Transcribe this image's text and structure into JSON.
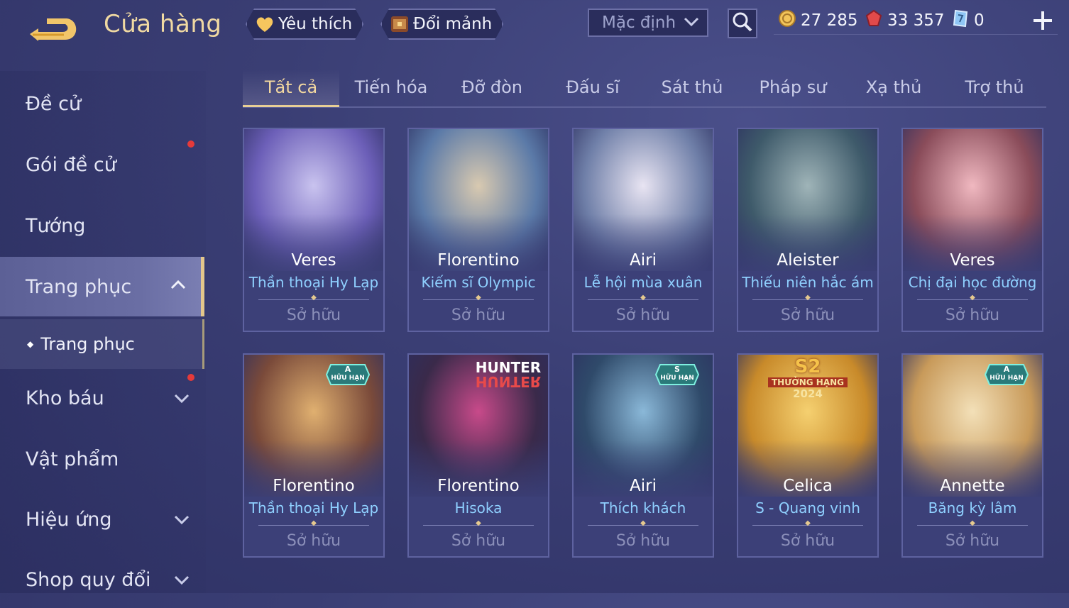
{
  "header": {
    "title": "Cửa hàng",
    "favorites_label": "Yêu thích",
    "exchange_label": "Đổi mảnh",
    "sort_value": "Mặc định",
    "currencies": [
      {
        "icon": "gold-coin-icon",
        "value": "27 285"
      },
      {
        "icon": "red-gem-icon",
        "value": "33 357"
      },
      {
        "icon": "voucher-icon",
        "value": "0"
      }
    ]
  },
  "sidebar": {
    "items": [
      {
        "label": "Đề cử"
      },
      {
        "label": "Gói đề cử"
      },
      {
        "label": "Tướng"
      },
      {
        "label": "Trang phục"
      },
      {
        "label": "Trang phục"
      },
      {
        "label": "Kho báu"
      },
      {
        "label": "Vật phẩm"
      },
      {
        "label": "Hiệu ứng"
      },
      {
        "label": "Shop quy đổi"
      }
    ]
  },
  "tabs": [
    "Tất cả",
    "Tiến hóa",
    "Đỡ đòn",
    "Đấu sĩ",
    "Sát thủ",
    "Pháp sư",
    "Xạ thủ",
    "Trợ thủ"
  ],
  "cards": [
    {
      "hero": "Veres",
      "skin": "Thần thoại Hy Lạp",
      "status": "Sở hữu",
      "palette": [
        "#6c5fb8",
        "#c9c3ef"
      ]
    },
    {
      "hero": "Florentino",
      "skin": "Kiếm sĩ Olympic",
      "status": "Sở hữu",
      "palette": [
        "#5b7aa8",
        "#d8c9b0"
      ]
    },
    {
      "hero": "Airi",
      "skin": "Lễ hội mùa xuân",
      "status": "Sở hữu",
      "palette": [
        "#6f7fa8",
        "#e8e4f2"
      ]
    },
    {
      "hero": "Aleister",
      "skin": "Thiếu niên hắc ám",
      "status": "Sở hữu",
      "palette": [
        "#3e5a6a",
        "#9fb4b8"
      ]
    },
    {
      "hero": "Veres",
      "skin": "Chị đại học đường",
      "status": "Sở hữu",
      "palette": [
        "#8a4c5a",
        "#f0b8c0"
      ]
    },
    {
      "hero": "Florentino",
      "skin": "Thần thoại Hy Lạp",
      "status": "Sở hữu",
      "palette": [
        "#7a4a3a",
        "#e0b070"
      ],
      "badge": {
        "grade": "A",
        "text": "HỮU HẠN"
      }
    },
    {
      "hero": "Florentino",
      "skin": "Hisoka",
      "status": "Sở hữu",
      "palette": [
        "#3a2a4a",
        "#c84a8a"
      ],
      "logo": {
        "line1": "HUNTER",
        "line2": "HUNTER"
      }
    },
    {
      "hero": "Airi",
      "skin": "Thích khách",
      "status": "Sở hữu",
      "palette": [
        "#2f4a6a",
        "#8ab8d8"
      ],
      "badge": {
        "grade": "S",
        "text": "HỮU HẠN"
      }
    },
    {
      "hero": "Celica",
      "skin": "S - Quang vinh",
      "status": "Sở hữu",
      "palette": [
        "#c88a2a",
        "#f5d070"
      ],
      "logo": {
        "line1": "S2",
        "line2": "THƯỞNG HẠNG",
        "line3": "2024"
      }
    },
    {
      "hero": "Annette",
      "skin": "Băng kỳ lâm",
      "status": "Sở hữu",
      "palette": [
        "#c89a5a",
        "#f3e0b8"
      ],
      "badge": {
        "grade": "A",
        "text": "HỮU HẠN"
      }
    }
  ]
}
